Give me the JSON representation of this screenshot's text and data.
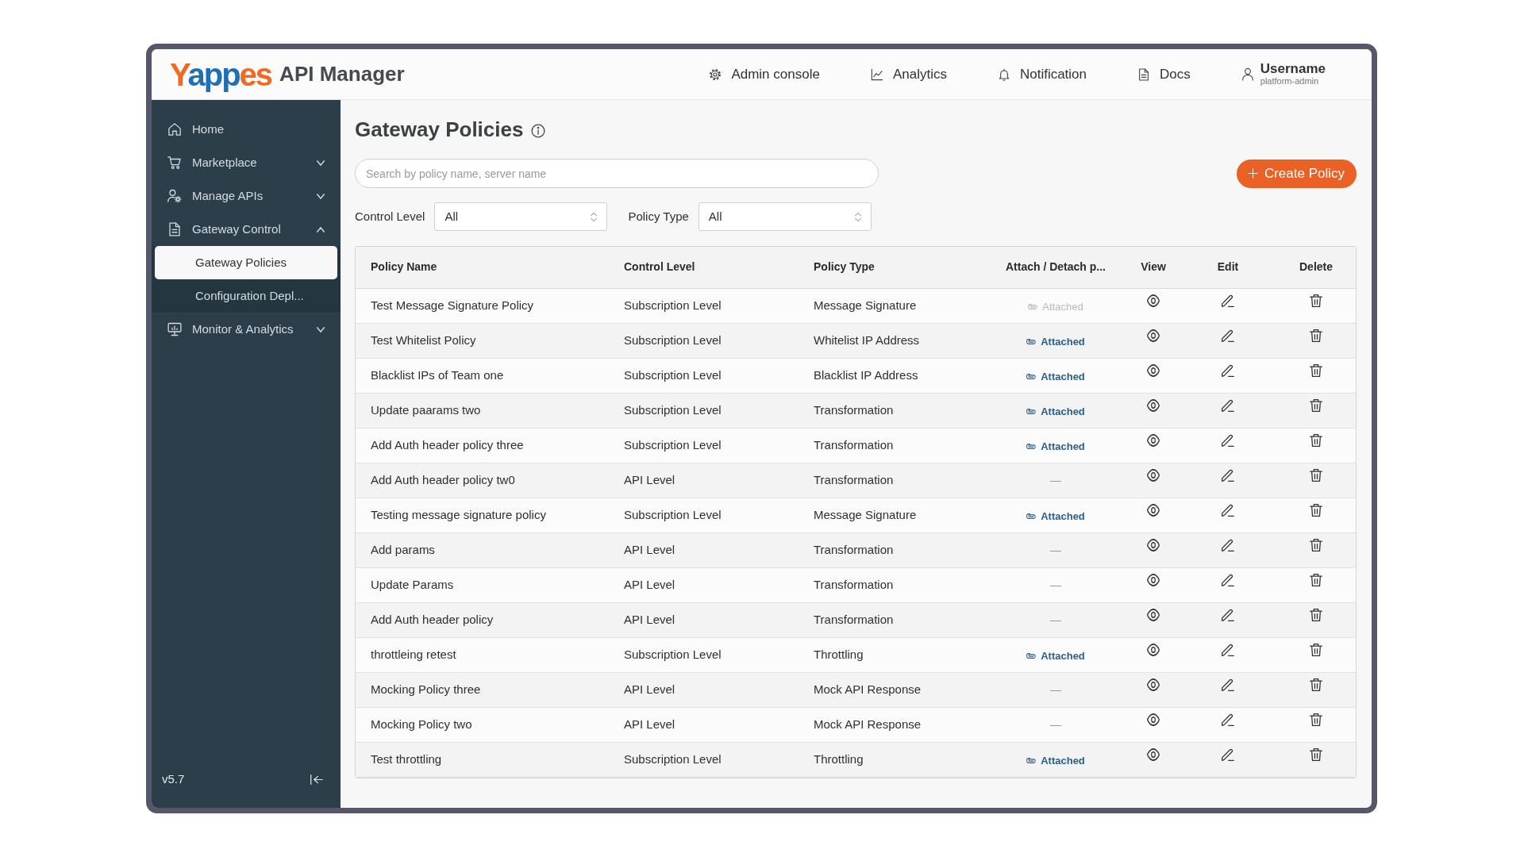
{
  "header": {
    "logo": {
      "parts": [
        "Y",
        "app",
        "es"
      ]
    },
    "product": "API Manager",
    "nav": [
      {
        "label": "Admin console"
      },
      {
        "label": "Analytics"
      },
      {
        "label": "Notification"
      },
      {
        "label": "Docs"
      }
    ],
    "user": {
      "name": "Username",
      "role": "platform-admin"
    }
  },
  "sidebar": {
    "items": [
      {
        "kind": "link",
        "label": "Home",
        "selected": false
      },
      {
        "kind": "group",
        "label": "Marketplace",
        "selected": false,
        "expanded": false
      },
      {
        "kind": "group",
        "label": "Manage APIs",
        "selected": false,
        "expanded": false
      },
      {
        "kind": "group",
        "label": "Gateway Control",
        "selected": false,
        "expanded": true,
        "children": [
          {
            "label": "Gateway Policies",
            "selected": true
          },
          {
            "label": "Configuration Depl...",
            "selected": false
          }
        ]
      },
      {
        "kind": "group",
        "label": "Monitor & Analytics",
        "selected": false,
        "expanded": false
      }
    ],
    "version": "v5.7"
  },
  "page": {
    "title": "Gateway Policies",
    "search": {
      "placeholder": "Search by policy name, server name"
    },
    "create_button": "Create Policy",
    "filters": [
      {
        "label": "Control Level",
        "value": "All"
      },
      {
        "label": "Policy Type",
        "value": "All"
      }
    ]
  },
  "table": {
    "columns": [
      "Policy Name",
      "Control Level",
      "Policy Type",
      "Attach / Detach p...",
      "View",
      "Edit",
      "Delete"
    ],
    "rows": [
      {
        "policy_name": "Test Message Signature Policy",
        "control_level": "Subscription Level",
        "policy_type": "Message Signature",
        "attach": {
          "kind": "attached",
          "label": "Attached",
          "disabled": true
        }
      },
      {
        "policy_name": "Test Whitelist Policy",
        "control_level": "Subscription Level",
        "policy_type": "Whitelist IP Address",
        "attach": {
          "kind": "attached",
          "label": "Attached",
          "disabled": false
        }
      },
      {
        "policy_name": "Blacklist IPs of Team one",
        "control_level": "Subscription Level",
        "policy_type": "Blacklist IP Address",
        "attach": {
          "kind": "attached",
          "label": "Attached",
          "disabled": false
        }
      },
      {
        "policy_name": "Update paarams two",
        "control_level": "Subscription Level",
        "policy_type": "Transformation",
        "attach": {
          "kind": "attached",
          "label": "Attached",
          "disabled": false
        }
      },
      {
        "policy_name": "Add Auth header policy three",
        "control_level": "Subscription Level",
        "policy_type": "Transformation",
        "attach": {
          "kind": "attached",
          "label": "Attached",
          "disabled": false
        }
      },
      {
        "policy_name": "Add Auth header policy tw0",
        "control_level": "API Level",
        "policy_type": "Transformation",
        "attach": {
          "kind": "none",
          "label": "—",
          "disabled": false
        }
      },
      {
        "policy_name": "Testing message signature policy",
        "control_level": "Subscription Level",
        "policy_type": "Message Signature",
        "attach": {
          "kind": "attached",
          "label": "Attached",
          "disabled": false
        }
      },
      {
        "policy_name": "Add params",
        "control_level": "API Level",
        "policy_type": "Transformation",
        "attach": {
          "kind": "none",
          "label": "—",
          "disabled": false
        }
      },
      {
        "policy_name": "Update Params",
        "control_level": "API Level",
        "policy_type": "Transformation",
        "attach": {
          "kind": "none",
          "label": "—",
          "disabled": false
        }
      },
      {
        "policy_name": "Add Auth header policy",
        "control_level": "API Level",
        "policy_type": "Transformation",
        "attach": {
          "kind": "none",
          "label": "—",
          "disabled": false
        }
      },
      {
        "policy_name": "throttleing retest",
        "control_level": "Subscription Level",
        "policy_type": "Throttling",
        "attach": {
          "kind": "attached",
          "label": "Attached",
          "disabled": false
        }
      },
      {
        "policy_name": "Mocking Policy three",
        "control_level": "API Level",
        "policy_type": "Mock API Response",
        "attach": {
          "kind": "none",
          "label": "—",
          "disabled": false
        }
      },
      {
        "policy_name": "Mocking Policy two",
        "control_level": "API Level",
        "policy_type": "Mock API Response",
        "attach": {
          "kind": "none",
          "label": "—",
          "disabled": false
        }
      },
      {
        "policy_name": "Test throttling",
        "control_level": "Subscription Level",
        "policy_type": "Throttling",
        "attach": {
          "kind": "attached",
          "label": "Attached",
          "disabled": false
        }
      }
    ]
  }
}
